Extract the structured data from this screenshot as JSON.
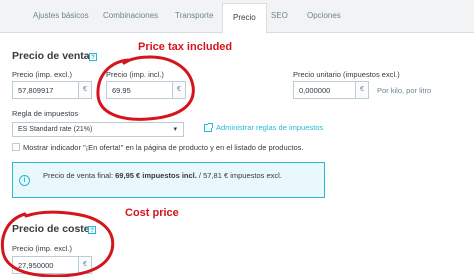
{
  "tabs": [
    {
      "label": "Ajustes básicos",
      "active": false
    },
    {
      "label": "Combinaciones",
      "active": false
    },
    {
      "label": "Transporte",
      "active": false
    },
    {
      "label": "Precio",
      "active": true
    },
    {
      "label": "SEO",
      "active": false
    },
    {
      "label": "Opciones",
      "active": false
    }
  ],
  "sale_price": {
    "title": "Precio de venta",
    "help": "?",
    "excl_label": "Precio (imp. excl.)",
    "excl_value": "57,809917",
    "incl_label": "Precio (imp. incl.)",
    "incl_value": "69.95",
    "currency": "€",
    "unit_label": "Precio unitario (impuestos excl.)",
    "unit_value": "0,000000",
    "unit_suffix": "Por kilo, por litro"
  },
  "tax": {
    "label": "Regla de impuestos",
    "selected": "ES Standard rate (21%)",
    "caret": "▾",
    "manage_link": "Administrar reglas de impuestos"
  },
  "on_sale": {
    "label": "Mostrar indicador \"¡En oferta!\" en la página de producto y en el listado de productos."
  },
  "summary": {
    "icon": "i",
    "prefix": "Precio de venta final: ",
    "bold": "69,95 € impuestos incl.",
    "suffix": " / 57,81 € impuestos excl."
  },
  "cost_price": {
    "title": "Precio de coste",
    "help": "?",
    "excl_label": "Precio (imp. excl.)",
    "excl_value": "27,950000",
    "currency": "€"
  },
  "annotations": {
    "price_tax_included": "Price tax included",
    "cost_price": "Cost price",
    "color": "#d4151b"
  },
  "colors": {
    "accent": "#25b9d7",
    "text": "#363a41",
    "border": "#bbcdd2"
  }
}
